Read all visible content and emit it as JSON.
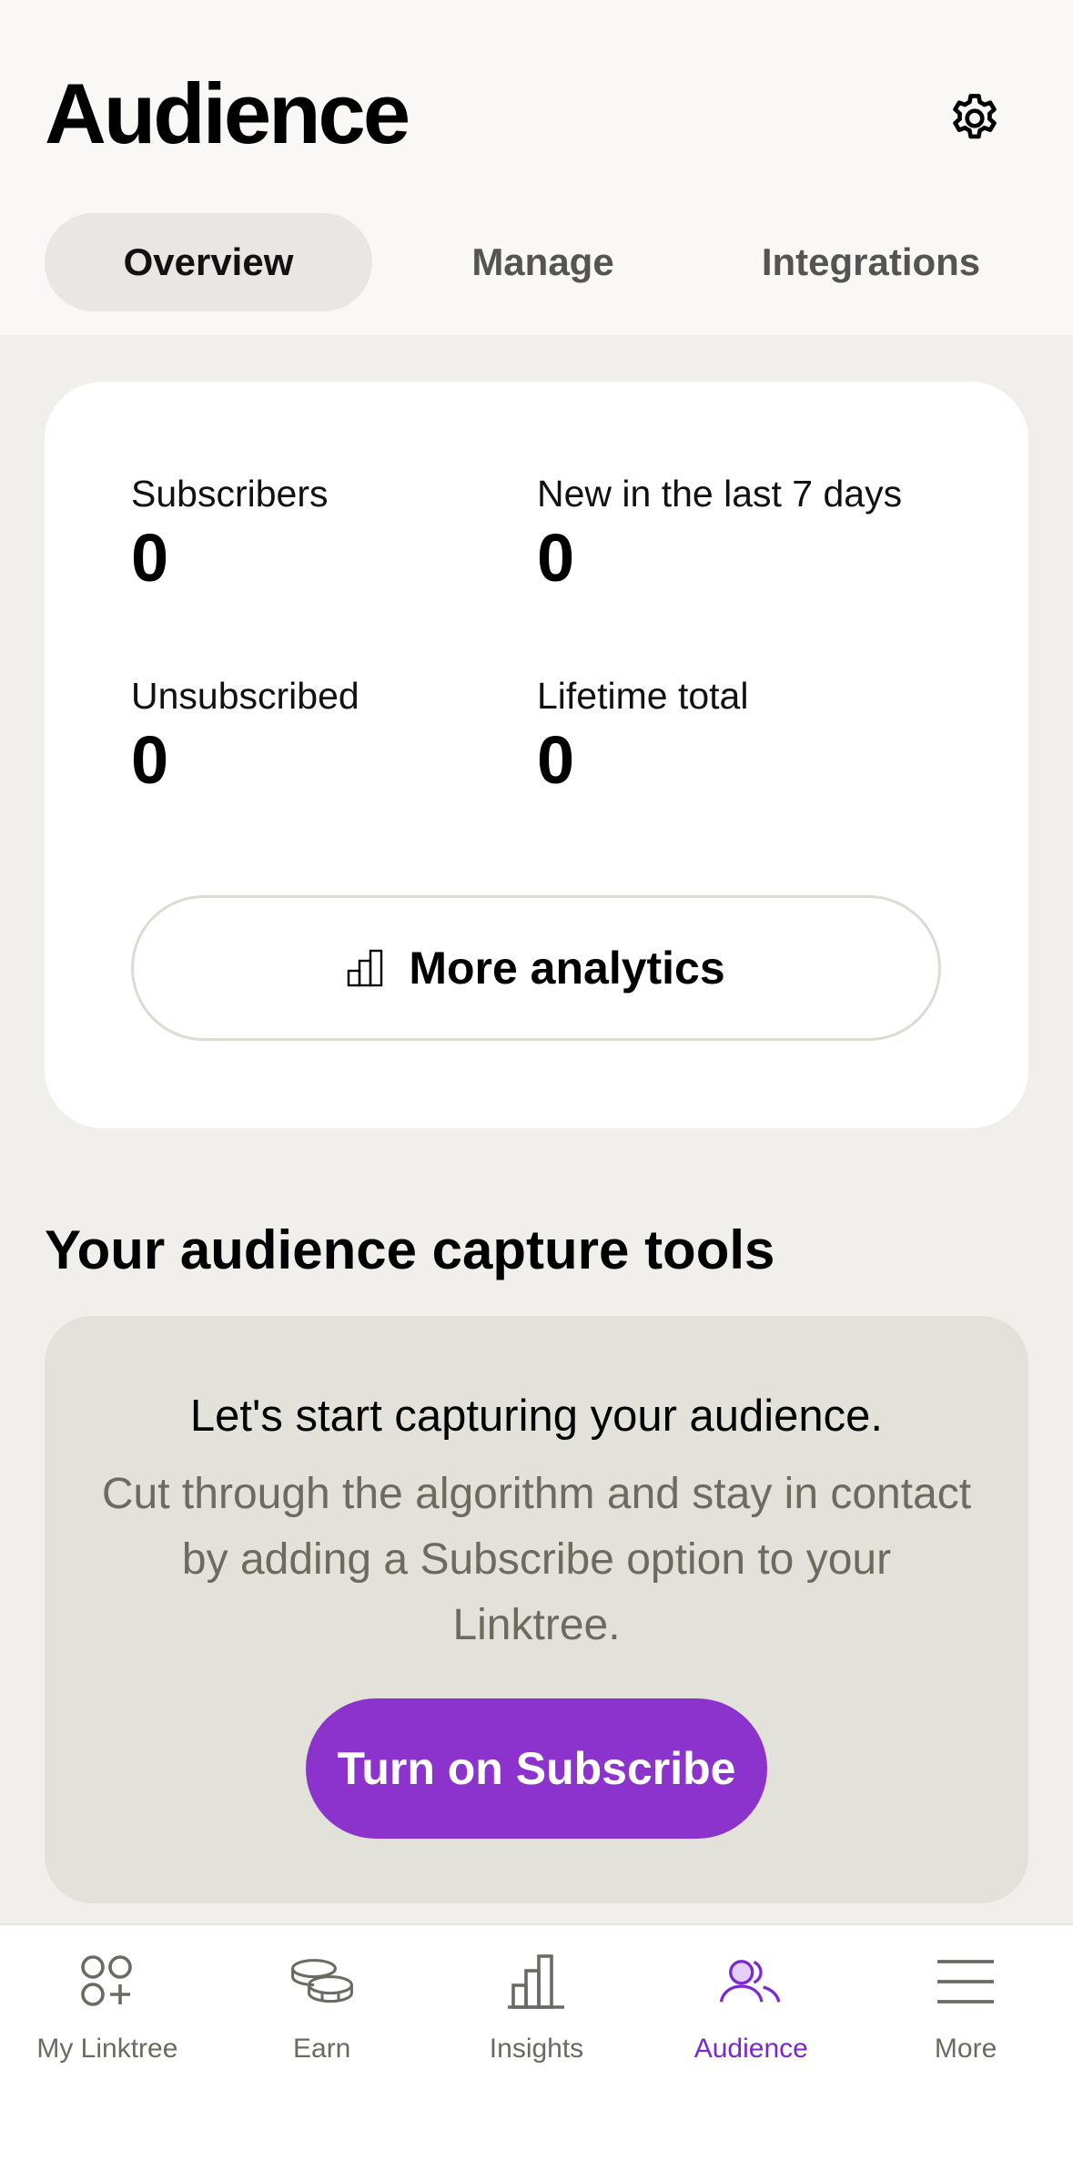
{
  "header": {
    "title": "Audience",
    "settings_icon": "gear-icon"
  },
  "tabs": [
    {
      "label": "Overview",
      "active": true
    },
    {
      "label": "Manage",
      "active": false
    },
    {
      "label": "Integrations",
      "active": false
    }
  ],
  "stats": [
    {
      "label": "Subscribers",
      "value": "0"
    },
    {
      "label": "New in the last 7 days",
      "value": "0"
    },
    {
      "label": "Unsubscribed",
      "value": "0"
    },
    {
      "label": "Lifetime total",
      "value": "0"
    }
  ],
  "analytics_button": {
    "label": "More analytics",
    "icon": "bar-chart-icon"
  },
  "capture": {
    "section_title": "Your audience capture tools",
    "title": "Let's start capturing your audience.",
    "description": "Cut through the algorithm and stay in contact by adding a Subscribe option to your Linktree.",
    "button_label": "Turn on Subscribe",
    "button_color": "#8b33cc"
  },
  "bottom_nav": [
    {
      "label": "My Linktree",
      "icon": "linktree-icon",
      "active": false
    },
    {
      "label": "Earn",
      "icon": "coins-icon",
      "active": false
    },
    {
      "label": "Insights",
      "icon": "bar-chart-icon",
      "active": false
    },
    {
      "label": "Audience",
      "icon": "people-icon",
      "active": true
    },
    {
      "label": "More",
      "icon": "menu-icon",
      "active": false
    }
  ],
  "colors": {
    "accent": "#7a27d6",
    "inactive": "#6b6a62"
  }
}
